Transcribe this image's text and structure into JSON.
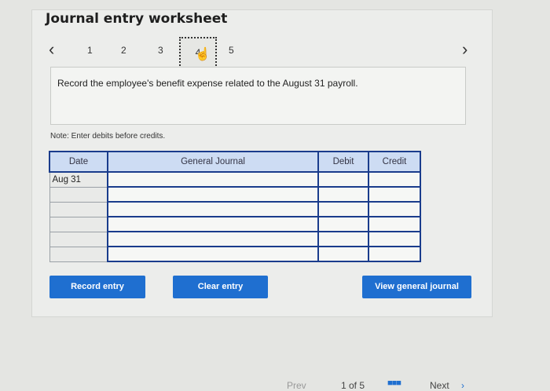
{
  "header": {
    "title": "Journal entry worksheet"
  },
  "nav": {
    "prev_icon": "‹",
    "next_icon": "›",
    "steps": [
      "1",
      "2",
      "3",
      "4",
      "5"
    ],
    "active_step": "4"
  },
  "prompt": "Record the employee's benefit expense related to the August 31 payroll.",
  "note": "Note: Enter debits before credits.",
  "table": {
    "headers": {
      "date": "Date",
      "journal": "General Journal",
      "debit": "Debit",
      "credit": "Credit"
    },
    "rows": [
      {
        "date": "Aug 31",
        "account": "",
        "debit": "",
        "credit": ""
      },
      {
        "date": "",
        "account": "",
        "debit": "",
        "credit": ""
      },
      {
        "date": "",
        "account": "",
        "debit": "",
        "credit": ""
      },
      {
        "date": "",
        "account": "",
        "debit": "",
        "credit": ""
      },
      {
        "date": "",
        "account": "",
        "debit": "",
        "credit": ""
      },
      {
        "date": "",
        "account": "",
        "debit": "",
        "credit": ""
      }
    ]
  },
  "buttons": {
    "record": "Record entry",
    "clear": "Clear entry",
    "view": "View general journal"
  },
  "footer": {
    "prev": "Prev",
    "page": "1 of 5",
    "next": "Next",
    "grid_icon": "grid-icon"
  },
  "colors": {
    "accent": "#1f6fd0",
    "table_border": "#1a3c8c",
    "header_bg": "#cddcf3"
  }
}
